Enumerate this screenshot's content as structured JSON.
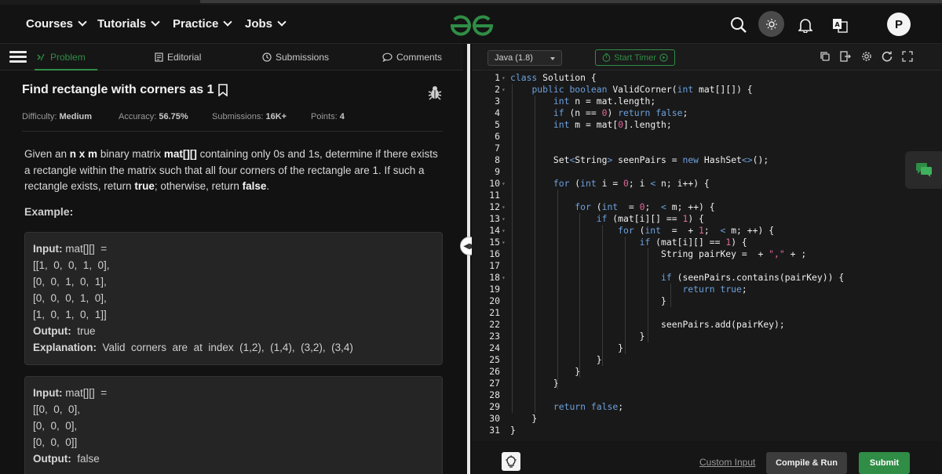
{
  "nav": {
    "items": [
      {
        "label": "Courses"
      },
      {
        "label": "Tutorials"
      },
      {
        "label": "Practice"
      },
      {
        "label": "Jobs"
      }
    ],
    "avatar_letter": "P"
  },
  "tabs": {
    "problem": "Problem",
    "editorial": "Editorial",
    "submissions": "Submissions",
    "comments": "Comments"
  },
  "problem": {
    "title": "Find rectangle with corners as 1",
    "difficulty_label": "Difficulty:",
    "difficulty": "Medium",
    "accuracy_label": "Accuracy:",
    "accuracy": "56.75%",
    "submissions_label": "Submissions:",
    "submissions": "16K+",
    "points_label": "Points:",
    "points": "4",
    "desc_1": "Given an ",
    "desc_nxm": "n x m",
    "desc_2": " binary matrix ",
    "desc_mat": "mat[][]",
    "desc_3": " containing only 0s and 1s, determine if there exists a rectangle within the matrix such that all four corners of the rectangle are 1. If such a rectangle exists, return ",
    "desc_true": "true",
    "desc_4": "; otherwise, return ",
    "desc_false": "false",
    "desc_5": ".",
    "example_label": "Example:",
    "examples": [
      {
        "input_key": "Input:",
        "input_val": " mat[][]  =",
        "rows": [
          "[[1,  0,  0,  1,  0],",
          "[0,  0,  1,  0,  1],",
          "[0,  0,  0,  1,  0],",
          "[1,  0,  1,  0,  1]]"
        ],
        "output_key": "Output:",
        "output_val": "  true",
        "expl_key": "Explanation:",
        "expl_val": "  Valid  corners  are  at  index  (1,2),  (1,4),  (3,2),  (3,4)"
      },
      {
        "input_key": "Input:",
        "input_val": " mat[][]  =",
        "rows": [
          "[[0,  0,  0],",
          "[0,  0,  0],",
          "[0,  0,  0]]"
        ],
        "output_key": "Output:",
        "output_val": "  false"
      }
    ]
  },
  "editor": {
    "language": "Java (1.8)",
    "timer_label": "Start Timer",
    "custom_input": "Custom Input",
    "compile_label": "Compile & Run",
    "submit_label": "Submit",
    "line_numbers": [
      "1",
      "2",
      "3",
      "4",
      "5",
      "6",
      "7",
      "8",
      "9",
      "10",
      "11",
      "12",
      "13",
      "14",
      "15",
      "16",
      "17",
      "18",
      "19",
      "20",
      "21",
      "22",
      "23",
      "24",
      "25",
      "26",
      "27",
      "28",
      "29",
      "30",
      "31"
    ]
  },
  "colors": {
    "accent": "#2f8d46",
    "keyword": "#6ca0dc",
    "literal": "#e0699a"
  }
}
